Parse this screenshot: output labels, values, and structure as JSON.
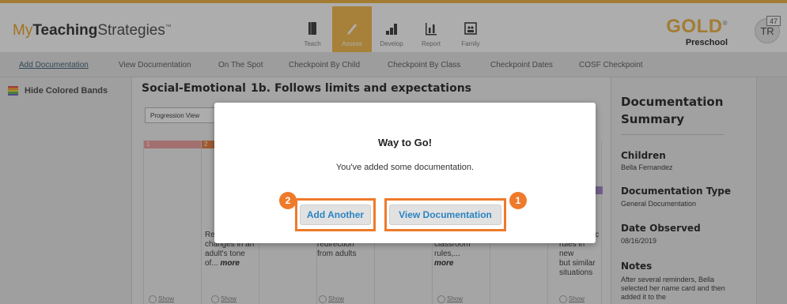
{
  "header": {
    "logo_my": "My",
    "logo_bold": "Teaching",
    "logo_rest": "Strategies",
    "logo_tm": "™",
    "nav": [
      {
        "label": "Teach"
      },
      {
        "label": "Assess"
      },
      {
        "label": "Develop"
      },
      {
        "label": "Report"
      },
      {
        "label": "Family"
      }
    ],
    "gold": "GOLD",
    "gold_reg": "®",
    "gold_sub": "Preschool",
    "avatar_initials": "TR",
    "badge_count": "47"
  },
  "subnav": [
    "Add Documentation",
    "View Documentation",
    "On The Spot",
    "Checkpoint By Child",
    "Checkpoint By Class",
    "Checkpoint Dates",
    "COSF Checkpoint"
  ],
  "left": {
    "hide_bands": "Hide Colored Bands"
  },
  "main": {
    "area": "Social-Emotional",
    "objective": "1b. Follows limits and expectations",
    "view_select": "Progression View",
    "help_icon": "?",
    "band_labels": [
      "1",
      "2"
    ],
    "snippets": [
      {
        "line1": "Res",
        "line2": "changes in an",
        "line3": "adult's tone",
        "line4": "of...",
        "more": "more"
      },
      {
        "line1": "redirection",
        "line2": "from adults"
      },
      {
        "line1": "classroom",
        "line2": "rules,...",
        "more": "more"
      },
      {
        "line1": "sic",
        "line2": "rules in new",
        "line3": "but similar",
        "line4": "situations"
      }
    ],
    "show_link": "Show"
  },
  "summary": {
    "title": "Documentation Summary",
    "children_label": "Children",
    "children_value": "Bella Fernandez",
    "doctype_label": "Documentation Type",
    "doctype_value": "General Documentation",
    "date_label": "Date Observed",
    "date_value": "08/16/2019",
    "notes_label": "Notes",
    "notes_value": "After several reminders, Bella selected her name card and then added it to the"
  },
  "modal": {
    "title": "Way to Go!",
    "message": "You've added some documentation.",
    "add_another": "Add Another",
    "view_documentation": "View Documentation",
    "marker_add": "2",
    "marker_view": "1"
  },
  "colors": {
    "accent": "#f6bf55",
    "highlight": "#ee7a2a",
    "button_text": "#2a84c2"
  }
}
